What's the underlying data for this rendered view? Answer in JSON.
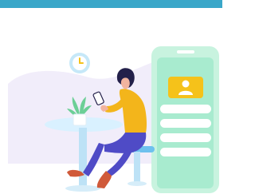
{
  "header": {
    "bar_color": "#3aa7c9"
  },
  "illustration": {
    "background_blob_color": "#f1edfa",
    "phone": {
      "frame_color": "#c8f3df",
      "screen_color": "#a8ebcf",
      "profile_card_color": "#f5c21a",
      "avatar_icon": "user-icon",
      "avatar_color": "#ffffff",
      "list_rows": 4,
      "row_color": "#ffffff"
    },
    "clock": {
      "icon": "clock-icon",
      "ring_color": "#c6e8f8",
      "face_color": "#ffffff",
      "hand_color": "#f5c21a"
    },
    "table": {
      "top_color": "#d9f1ff",
      "stem_color": "#bde2f6"
    },
    "plant": {
      "icon": "plant-icon",
      "leaf_color": "#6ccf96",
      "pot_color": "#ffffff"
    },
    "person": {
      "hair_color": "#23204a",
      "top_color": "#f3b51b",
      "pants_color": "#4f4bc6",
      "shoe_color": "#d05a3a",
      "skin_color": "#f2b49f"
    },
    "stool": {
      "seat_color": "#6ec1ee",
      "stem_color": "#bde2f6"
    }
  }
}
